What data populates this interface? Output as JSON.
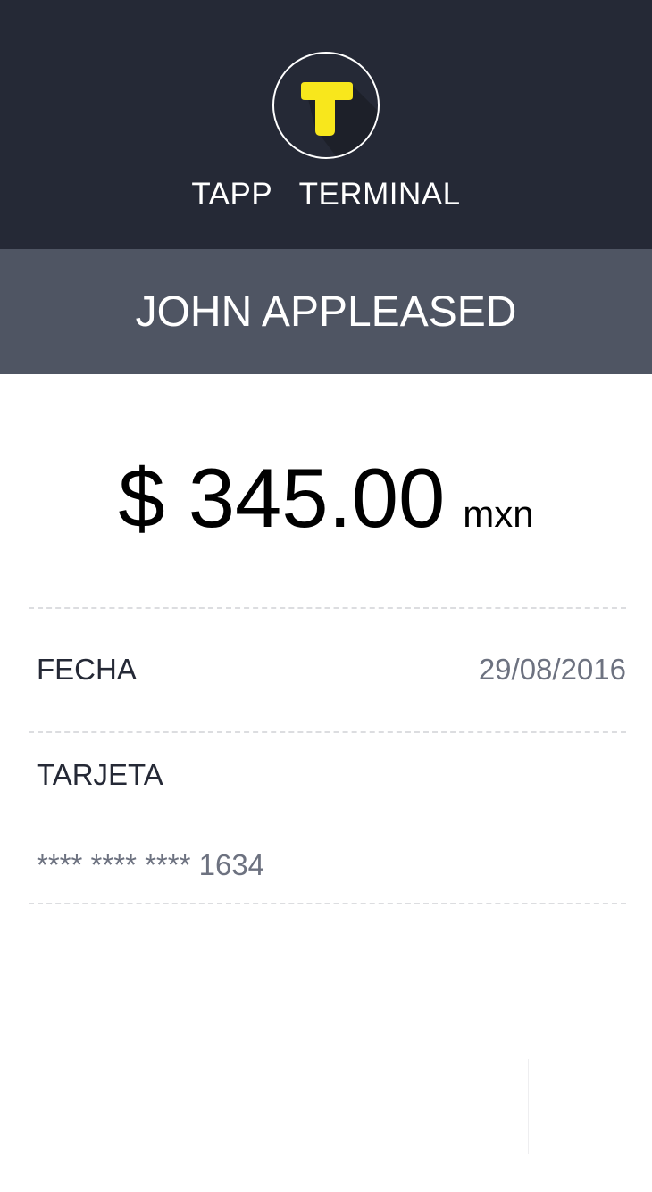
{
  "app": {
    "title": "TAPP   TERMINAL",
    "logo_letter": "T",
    "logo_icon": "tapp-logo-icon"
  },
  "customer": {
    "name": "JOHN APPLEASED"
  },
  "payment": {
    "amount": "$ 345.00",
    "currency": "mxn"
  },
  "details": {
    "date_label": "FECHA",
    "date_value": "29/08/2016",
    "card_label": "TARJETA",
    "card_number": "**** **** **** 1634"
  },
  "colors": {
    "header_bg": "#252936",
    "name_bar_bg": "#4f5563",
    "logo_accent": "#f8e71c",
    "text_dark": "#252936",
    "text_muted": "#6d7280",
    "divider": "#dcdde0"
  }
}
